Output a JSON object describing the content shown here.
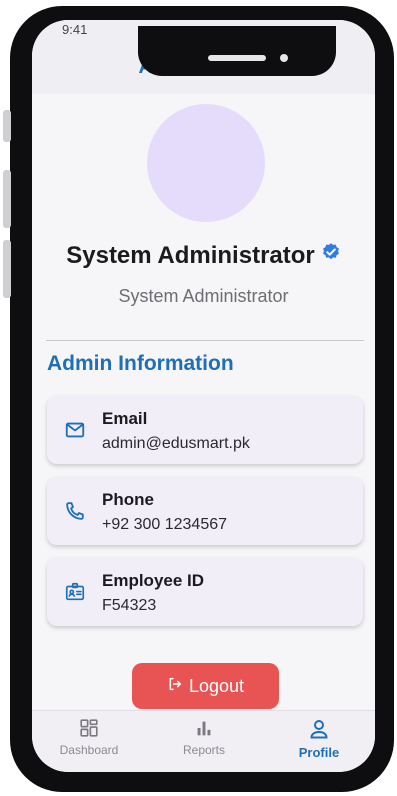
{
  "status": {
    "time": "9:41"
  },
  "header": {
    "title": "Admin Profile"
  },
  "profile": {
    "name": "System Administrator",
    "role": "System Administrator",
    "verified": true
  },
  "section": {
    "title": "Admin Information"
  },
  "info": [
    {
      "icon": "mail-icon",
      "label": "Email",
      "value": "admin@edusmart.pk"
    },
    {
      "icon": "phone-icon",
      "label": "Phone",
      "value": "+92 300 1234567"
    },
    {
      "icon": "id-badge-icon",
      "label": "Employee ID",
      "value": "F54323"
    }
  ],
  "logout": {
    "label": "Logout"
  },
  "nav": {
    "items": [
      {
        "label": "Dashboard",
        "icon": "dashboard-icon",
        "active": false
      },
      {
        "label": "Reports",
        "icon": "reports-icon",
        "active": false
      },
      {
        "label": "Profile",
        "icon": "profile-icon",
        "active": true
      }
    ]
  },
  "colors": {
    "accent": "#1f6fb8",
    "logout": "#e85353",
    "avatar": "#e5dcfb",
    "card": "#f2eef8"
  }
}
